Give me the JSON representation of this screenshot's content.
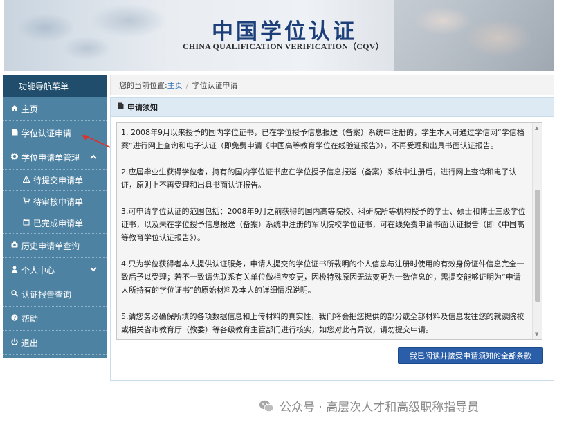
{
  "banner": {
    "title_cn": "中国学位认证",
    "title_en": "CHINA QUALIFICATION VERIFICATION（CQV）"
  },
  "sidebar": {
    "header": "功能导航菜单",
    "items": [
      {
        "label": "主页",
        "icon": "home-icon"
      },
      {
        "label": "学位认证申请",
        "icon": "document-icon"
      },
      {
        "label": "学位申请单管理",
        "icon": "gear-icon"
      },
      {
        "label": "待提交申请单",
        "icon": "warning-icon"
      },
      {
        "label": "待审核申请单",
        "icon": "cart-icon"
      },
      {
        "label": "已完成申请单",
        "icon": "calendar-icon"
      },
      {
        "label": "历史申请单查询",
        "icon": "camera-icon"
      },
      {
        "label": "个人中心",
        "icon": "user-icon"
      },
      {
        "label": "认证报告查询",
        "icon": "search-icon"
      },
      {
        "label": "帮助",
        "icon": "help-icon"
      },
      {
        "label": "退出",
        "icon": "power-icon"
      }
    ]
  },
  "breadcrumb": {
    "prefix": "您的当前位置:",
    "home": "主页",
    "separator": "/",
    "current": "学位认证申请"
  },
  "panel": {
    "title": "申请须知",
    "paragraphs": [
      "1. 2008年9月以来授予的国内学位证书，已在学位授予信息报送（备案）系统中注册的，学生本人可通过学信网“学信档案”进行网上查询和电子认证（即免费申请《中国高等教育学位在线验证报告》），不再受理和出具书面认证报告。",
      "2.应届毕业生获得学位者，持有的国内学位证书应在学位授予信息报送（备案）系统中注册后，进行网上查询和电子认证，原则上不再受理和出具书面认证报告。",
      "3.可申请学位认证的范围包括：2008年9月之前获得的国内高等院校、科研院所等机构授予的学士、硕士和博士三级学位证书，以及未在学位授予信息报送（备案）系统中注册的军队院校学位证书，可在线免费申请书面认证报告（即《中国高等教育学位认证报告》）。",
      "4.只为学位获得者本人提供认证服务，申请人提交的学位证书所载明的个人信息与注册时使用的有效身份证件信息完全一致后予以受理；若不一致请先联系有关单位做相应变更，因极特殊原因无法变更为一致信息的，需提交能够证明为“申请人所持有的学位证书”的原始材料及本人的详细情况说明。",
      "5.请您务必确保所填的各项数据信息和上传材料的真实性，我们将会把您提供的部分或全部材料及信息发往您的就读院校或相关省市教育厅（教委）等各级教育主管部门进行核实，如您对此有异议，请勿提交申请。"
    ],
    "accept_button": "我已阅读并接受申请须知的全部条款"
  },
  "watermark": {
    "text": "公众号 · 高层次人才和高级职称指导员"
  }
}
